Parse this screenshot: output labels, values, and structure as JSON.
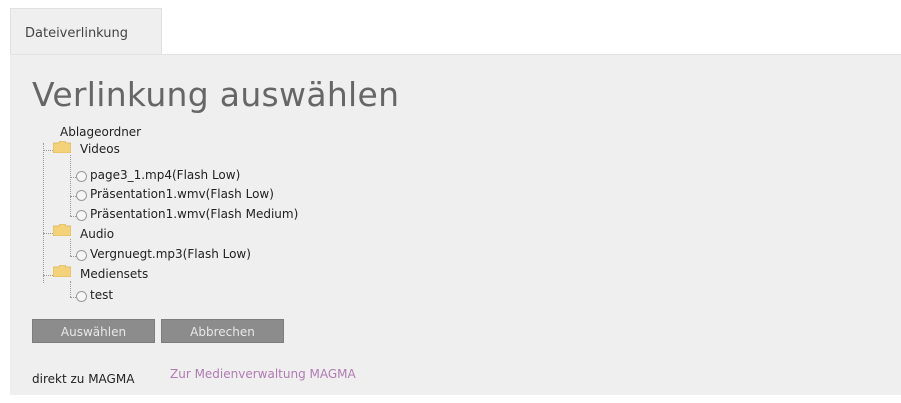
{
  "tab": {
    "label": "Dateiverlinkung"
  },
  "heading": "Verlinkung auswählen",
  "tree": {
    "root_label": "Ablageordner",
    "folders": [
      {
        "label": "Videos",
        "icon": "folder-icon",
        "files": [
          "page3_1.mp4(Flash Low)",
          "Präsentation1.wmv(Flash Low)",
          "Präsentation1.wmv(Flash Medium)"
        ]
      },
      {
        "label": "Audio",
        "icon": "folder-icon",
        "files": [
          "Vergnuegt.mp3(Flash Low)"
        ]
      },
      {
        "label": "Mediensets",
        "icon": "folder-icon",
        "files": [
          "test"
        ]
      }
    ]
  },
  "buttons": {
    "select": "Auswählen",
    "cancel": "Abbrechen"
  },
  "footer": {
    "text": "direkt zu MAGMA",
    "link": "Zur Medienverwaltung MAGMA"
  },
  "colors": {
    "panel_bg": "#efefef",
    "button_bg": "#8c8c8c",
    "link": "#b07bb3",
    "folder": "#f3d27a"
  }
}
